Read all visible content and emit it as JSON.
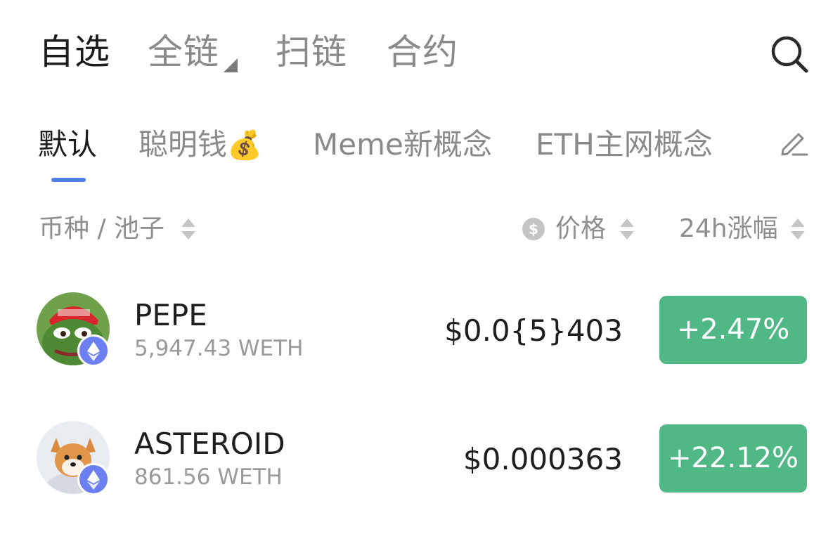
{
  "top_tabs": [
    "自选",
    "全链",
    "扫链",
    "合约"
  ],
  "sub_tabs": [
    "默认",
    "聪明钱",
    "Meme新概念",
    "ETH主网概念"
  ],
  "sub_tab_emoji": "💰",
  "columns": {
    "token_pool": "币种 / 池子",
    "price": "价格",
    "price_icon": "$",
    "change_24h": "24h涨幅"
  },
  "rows": [
    {
      "symbol": "PEPE",
      "pool": "5,947.43 WETH",
      "price": "$0.0{5}403",
      "change": "+2.47%",
      "icon": "pepe-frog-avatar"
    },
    {
      "symbol": "ASTEROID",
      "pool": "861.56 WETH",
      "price": "$0.000363",
      "change": "+22.12%",
      "icon": "shiba-astronaut-avatar"
    }
  ],
  "colors": {
    "accent": "#4f80f0",
    "positive": "#4fb884",
    "eth_badge": "#6b7ff0"
  }
}
